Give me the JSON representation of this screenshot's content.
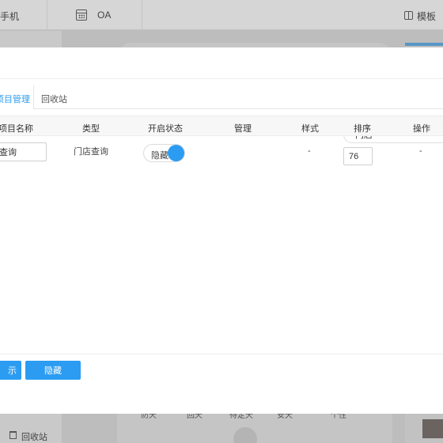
{
  "topbar": {
    "phone_label": "手机",
    "oa_label": "OA",
    "template_label": "模板"
  },
  "background": {
    "recycle_label": "回收站",
    "tab_labels": [
      "防天",
      "回天",
      "待定天",
      "安天",
      "个性"
    ]
  },
  "modal": {
    "tabs": [
      {
        "label": "项目管理",
        "active": true
      },
      {
        "label": "回收站",
        "active": false
      }
    ],
    "search": {
      "value": "门店",
      "placeholder": ""
    },
    "columns": [
      "项目名称",
      "类型",
      "开启状态",
      "管理",
      "样式",
      "排序",
      "操作"
    ],
    "rows": [
      {
        "name": "查询",
        "type": "门店查询",
        "status_label": "隐藏",
        "enabled": true,
        "manage": "",
        "style": "-",
        "sort": "76",
        "action": "-"
      }
    ],
    "buttons": {
      "primary_partial": "示",
      "hide": "隐藏"
    }
  },
  "colors": {
    "accent": "#2b9cf2",
    "overlay": "#bdbdbd"
  }
}
